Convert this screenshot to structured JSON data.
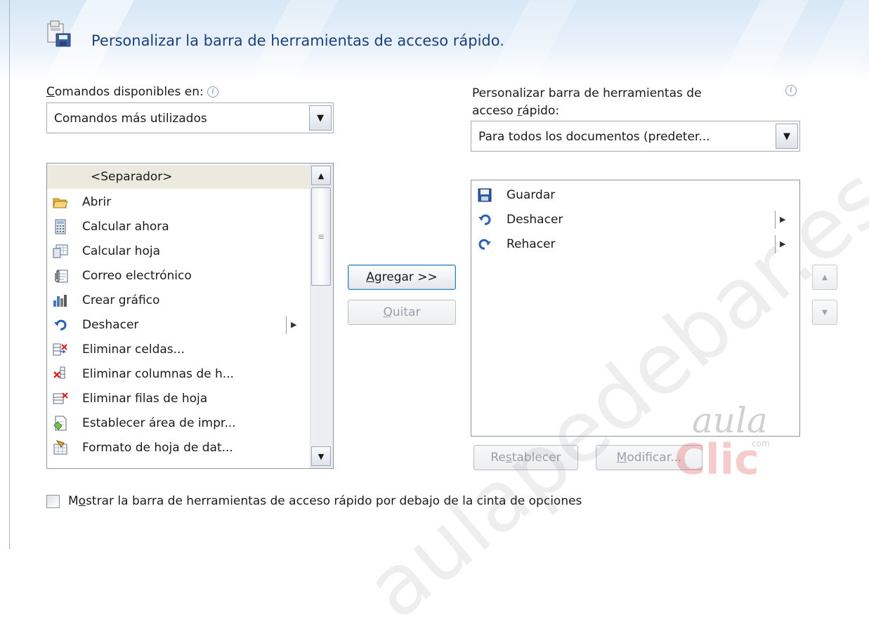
{
  "dialog": {
    "title": "Personalizar la barra de herramientas de acceso rápido."
  },
  "available": {
    "label_prefix": "",
    "label_key": "C",
    "label_rest": "omandos disponibles en:",
    "combo_value": "Comandos más utilizados",
    "items": [
      {
        "label": "<Separador>",
        "icon": "separator",
        "separator": true
      },
      {
        "label": "Abrir",
        "icon": "folder-open-icon"
      },
      {
        "label": "Calcular ahora",
        "icon": "calculator-icon"
      },
      {
        "label": "Calcular hoja",
        "icon": "calculate-sheet-icon"
      },
      {
        "label": "Correo electrónico",
        "icon": "email-icon"
      },
      {
        "label": "Crear gráfico",
        "icon": "chart-icon"
      },
      {
        "label": "Deshacer",
        "icon": "undo-icon",
        "submenu": true
      },
      {
        "label": "Eliminar celdas...",
        "icon": "delete-cells-icon"
      },
      {
        "label": "Eliminar columnas de h...",
        "icon": "delete-columns-icon"
      },
      {
        "label": "Eliminar filas de hoja",
        "icon": "delete-rows-icon"
      },
      {
        "label": "Establecer área de impr...",
        "icon": "print-area-icon"
      },
      {
        "label": "Formato de hoja de dat...",
        "icon": "sheet-format-icon"
      }
    ]
  },
  "customize": {
    "label_line1": "Personalizar barra de herramientas de",
    "label_line2_prefix": "acceso ",
    "label_line2_key": "r",
    "label_line2_rest": "ápido:",
    "combo_value": "Para todos los documentos (predeter...",
    "items": [
      {
        "label": "Guardar",
        "icon": "save-icon"
      },
      {
        "label": "Deshacer",
        "icon": "undo-icon",
        "submenu": true
      },
      {
        "label": "Rehacer",
        "icon": "redo-icon",
        "submenu": true
      }
    ]
  },
  "buttons": {
    "add_key": "A",
    "add_rest": "gregar >>",
    "remove_key": "Q",
    "remove_rest": "uitar",
    "reset_prefix": "Re",
    "reset_key": "s",
    "reset_rest": "tablecer",
    "modify_key": "M",
    "modify_rest": "odificar..."
  },
  "checkbox": {
    "prefix": "M",
    "key": "o",
    "rest": "strar la barra de herramientas de acceso rápido por debajo de la cinta de opciones"
  },
  "watermark": {
    "site": "aulapedebar.es",
    "logo_word1": "aula",
    "logo_word2": "Clic",
    "logo_sub": "com"
  },
  "colors": {
    "title": "#1e3f7d",
    "header_gradient_top": "#d7e7f6",
    "separator_row": "#ece9df"
  }
}
